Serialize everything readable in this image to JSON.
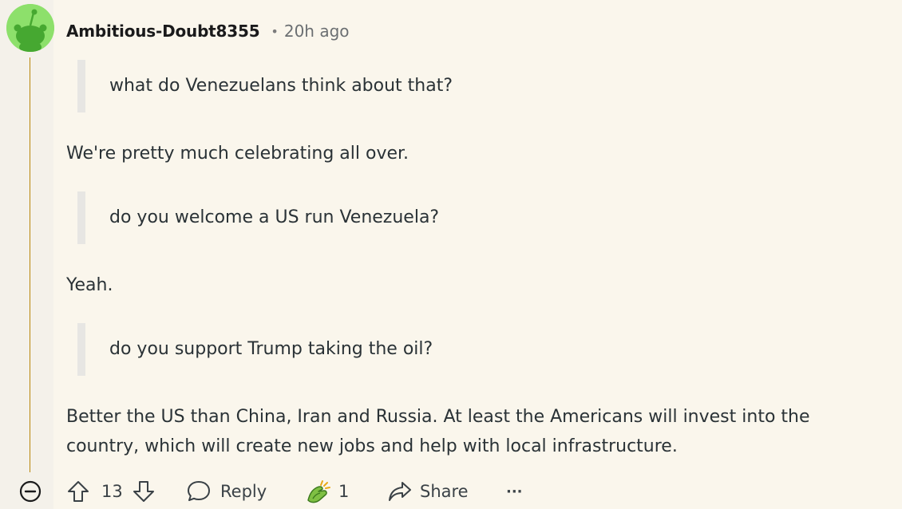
{
  "comment": {
    "username": "Ambitious-Doubt8355",
    "separator": "•",
    "timestamp": "20h ago"
  },
  "body": {
    "quote1": "what do Venezuelans think about that?",
    "para1": "We're pretty much celebrating all over.",
    "quote2": "do you welcome a US run Venezuela?",
    "para2": "Yeah.",
    "quote3": "do you support Trump taking the oil?",
    "para3_line1": "Better the US than China, Iran and Russia. At least the Americans will invest into the",
    "para3_line2": "country, which will create new jobs and help with local infrastructure."
  },
  "actions": {
    "vote_count": "13",
    "reply_label": "Reply",
    "award_count": "1",
    "share_label": "Share",
    "more_label": "···"
  },
  "icons": {
    "collapse": "minus-circle-icon",
    "upvote": "arrow-up-icon",
    "downvote": "arrow-down-icon",
    "reply": "speech-bubble-icon",
    "award": "hands-award-icon",
    "share": "share-arrow-icon",
    "more": "ellipsis-icon"
  },
  "colors": {
    "background": "#faf6ec",
    "avatar": "#8de06b",
    "thread_line": "#b8860b",
    "quote_bar": "#e7e6e3",
    "text": "#2a3236"
  }
}
